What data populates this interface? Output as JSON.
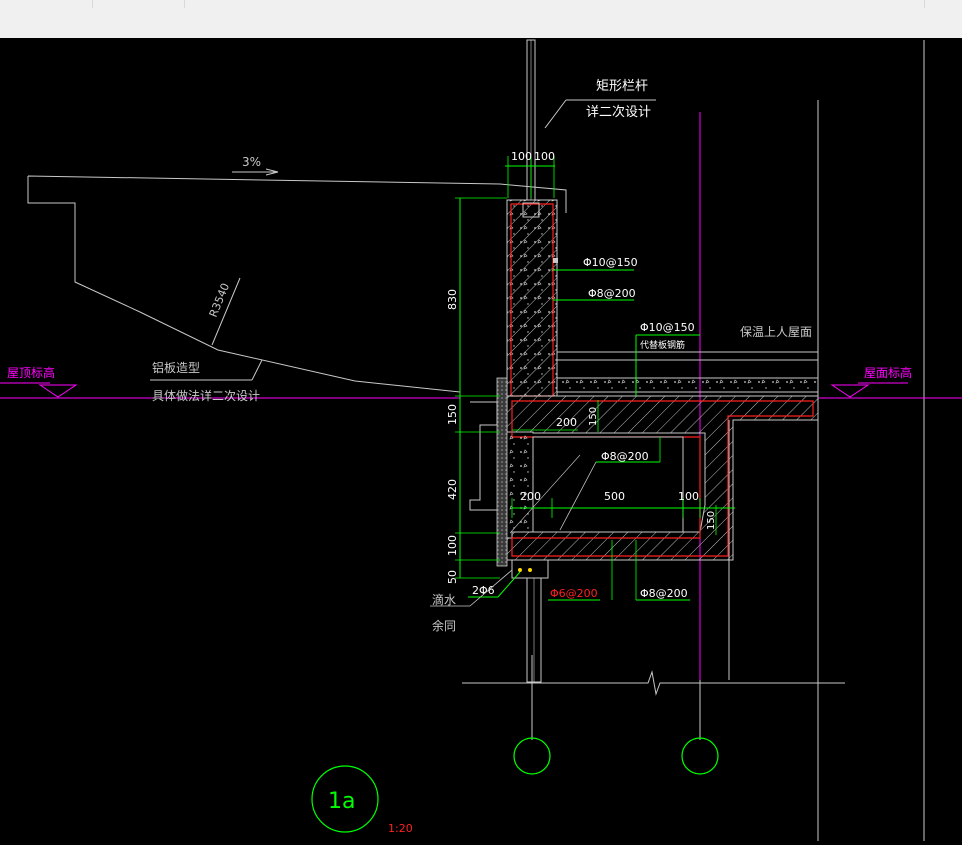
{
  "labels": {
    "railing_line1": "矩形栏杆",
    "railing_line2": "详二次设计",
    "slope": "3%",
    "radius": "R3540",
    "roof_level_left": "屋顶标高",
    "aluminum_line1": "铝板造型",
    "aluminum_line2": "具体做法详二次设计",
    "rebar_top1": "Φ10@150",
    "rebar_top2": "Φ8@200",
    "rebar_slab1": "Φ10@150",
    "rebar_slab2": "代替板钢筋",
    "roof_finish": "保温上人屋面",
    "roof_level_right": "屋面标高",
    "rebar_mid": "Φ8@200",
    "rebar_bottom_left": "2Φ6",
    "rebar_bottom_red": "Φ6@200",
    "rebar_bottom_right": "Φ8@200",
    "drip": "滴水",
    "rest": "余同",
    "detail_id": "1a",
    "scale": "1:20"
  },
  "dimensions": {
    "top_left": "100",
    "top_right": "100",
    "vertical_830": "830",
    "vertical_150": "150",
    "vertical_420": "420",
    "vertical_100": "100",
    "vertical_50": "50",
    "inner_200_top": "200",
    "inner_150_top": "150",
    "inner_200": "200",
    "inner_500": "500",
    "inner_100": "100",
    "inner_150_right": "150"
  },
  "colors": {
    "background": "#000000",
    "outline": "#c8c8c8",
    "dimension": "#00ff00",
    "concrete_edge": "#ff2020",
    "level_mark": "#ff00ff",
    "text": "#ffffff"
  }
}
